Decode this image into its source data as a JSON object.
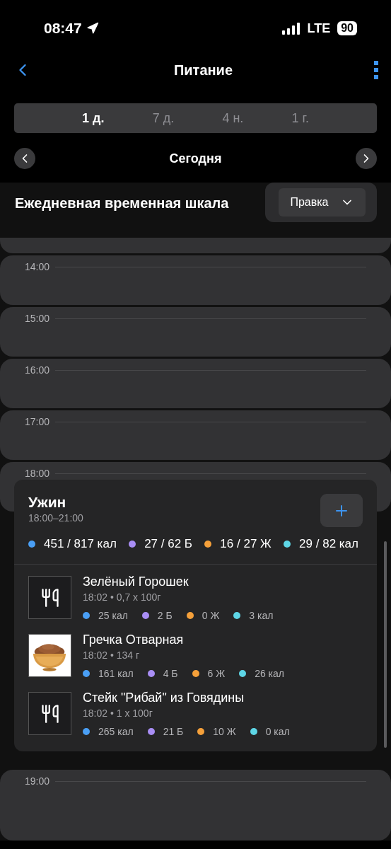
{
  "status_bar": {
    "time": "08:47",
    "network": "LTE",
    "battery": "90"
  },
  "nav": {
    "title": "Питание"
  },
  "periods": [
    {
      "label": "1 д.",
      "selected": true
    },
    {
      "label": "7 д.",
      "selected": false
    },
    {
      "label": "4 н.",
      "selected": false
    },
    {
      "label": "1 г.",
      "selected": false
    }
  ],
  "date_nav": {
    "label": "Сегодня"
  },
  "section": {
    "title": "Ежедневная временная шкала",
    "edit_button": "Правка"
  },
  "hours_before": [
    "14:00",
    "15:00",
    "16:00",
    "17:00",
    "18:00"
  ],
  "meal": {
    "title": "Ужин",
    "time": "18:00–21:00",
    "totals": [
      {
        "text": "451 / 817 кал",
        "color": "#4a9ff5"
      },
      {
        "text": "27 / 62 Б",
        "color": "#a98ef5"
      },
      {
        "text": "16 / 27 Ж",
        "color": "#f5a03a"
      },
      {
        "text": "29 / 82 кал",
        "color": "#5ed6e6"
      }
    ],
    "items": [
      {
        "kind": "placeholder",
        "name": "Зелёный Горошек",
        "detail": "18:02 • 0,7 x 100г",
        "nutrients": [
          {
            "text": "25 кал",
            "color": "#4a9ff5"
          },
          {
            "text": "2 Б",
            "color": "#a98ef5"
          },
          {
            "text": "0 Ж",
            "color": "#f5a03a"
          },
          {
            "text": "3 кал",
            "color": "#5ed6e6"
          }
        ]
      },
      {
        "kind": "picture",
        "name": "Гречка Отварная",
        "detail": "18:02 • 134 г",
        "nutrients": [
          {
            "text": "161 кал",
            "color": "#4a9ff5"
          },
          {
            "text": "4 Б",
            "color": "#a98ef5"
          },
          {
            "text": "6 Ж",
            "color": "#f5a03a"
          },
          {
            "text": "26 кал",
            "color": "#5ed6e6"
          }
        ]
      },
      {
        "kind": "placeholder",
        "name": "Стейк \"Рибай\" из Говядины",
        "detail": "18:02 • 1 x 100г",
        "nutrients": [
          {
            "text": "265 кал",
            "color": "#4a9ff5"
          },
          {
            "text": "21 Б",
            "color": "#a98ef5"
          },
          {
            "text": "10 Ж",
            "color": "#f5a03a"
          },
          {
            "text": "0 кал",
            "color": "#5ed6e6"
          }
        ]
      }
    ]
  },
  "hours_after": [
    "19:00"
  ]
}
